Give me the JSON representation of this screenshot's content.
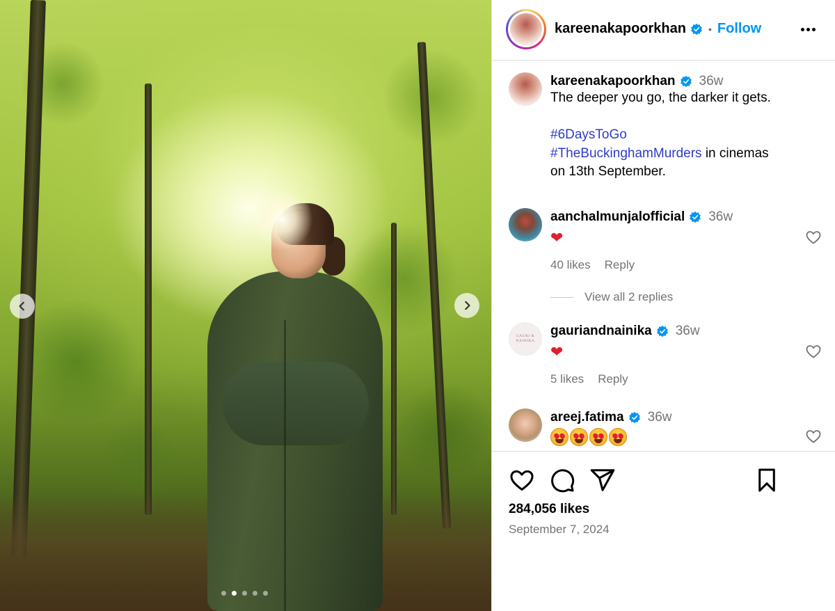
{
  "header": {
    "username": "kareenakapoorkhan",
    "separator": "•",
    "follow_label": "Follow"
  },
  "post": {
    "author": "kareenakapoorkhan",
    "time": "36w",
    "caption_line1": "The deeper you go, the darker it gets.",
    "hashtag1": "#6DaysToGo",
    "hashtag2": "#TheBuckinghamMurders",
    "caption_tail1": " in cinemas",
    "caption_tail2": "on 13th September."
  },
  "comments": [
    {
      "username": "aanchalmunjalofficial",
      "time": "36w",
      "text": "❤",
      "likes": "40 likes",
      "reply": "Reply",
      "view_replies": "View all 2 replies"
    },
    {
      "username": "gauriandnainika",
      "time": "36w",
      "text": "❤",
      "likes": "5 likes",
      "reply": "Reply",
      "avatar_text": "GAURI & NAINIKA"
    },
    {
      "username": "areej.fatima",
      "time": "36w",
      "emoji_count": 4
    }
  ],
  "footer": {
    "likes": "284,056 likes",
    "date": "September 7, 2024"
  },
  "carousel": {
    "slides": 5,
    "active_index": 1
  },
  "colors": {
    "link": "#0095f6",
    "hashtag": "#2d3bc9",
    "verified": "#0095f6",
    "secondary_text": "#737373"
  },
  "icons": [
    "chevron-left-icon",
    "chevron-right-icon",
    "verified-icon",
    "more-icon",
    "heart-icon",
    "comment-icon",
    "share-icon",
    "bookmark-icon"
  ]
}
